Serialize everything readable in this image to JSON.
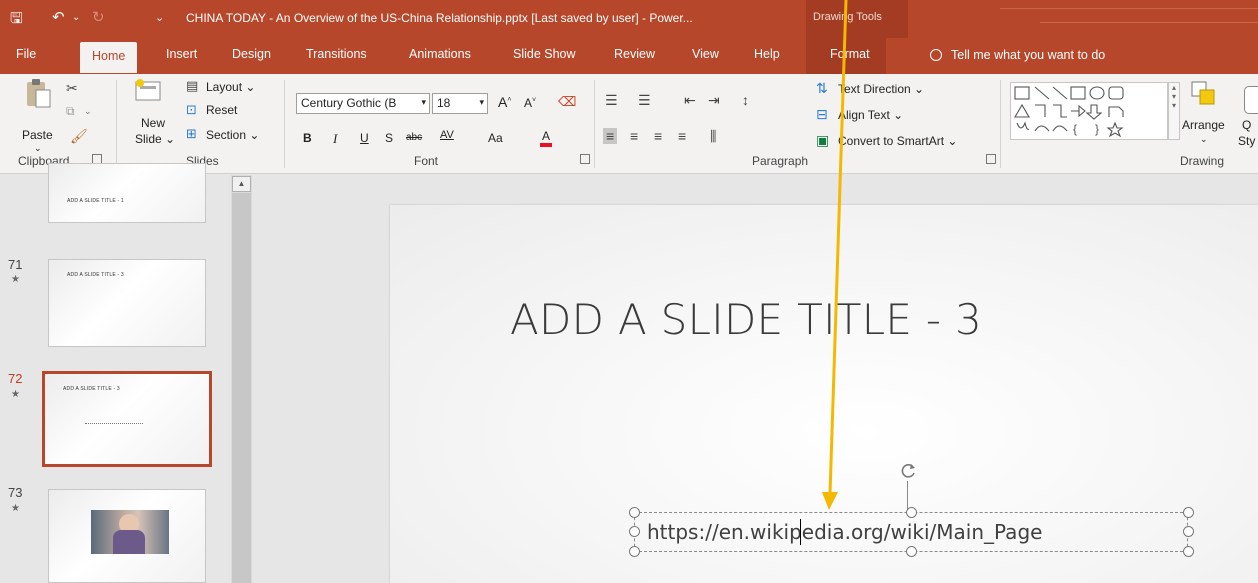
{
  "window": {
    "title": "CHINA TODAY - An Overview of the US-China Relationship.pptx [Last saved by user]  -  Power...",
    "context_title": "Drawing Tools"
  },
  "tabs": [
    {
      "label": "File"
    },
    {
      "label": "Home"
    },
    {
      "label": "Insert"
    },
    {
      "label": "Design"
    },
    {
      "label": "Transitions"
    },
    {
      "label": "Animations"
    },
    {
      "label": "Slide Show"
    },
    {
      "label": "Review"
    },
    {
      "label": "View"
    },
    {
      "label": "Help"
    },
    {
      "label": "Format"
    }
  ],
  "tell_me": "Tell me what you want to do",
  "ribbon": {
    "clipboard": {
      "label": "Clipboard",
      "paste": "Paste"
    },
    "slides": {
      "label": "Slides",
      "new_slide_1": "New",
      "new_slide_2": "Slide ⌄",
      "layout": "Layout ⌄",
      "reset": "Reset",
      "section": "Section ⌄"
    },
    "font": {
      "label": "Font",
      "font_name": "Century Gothic (B",
      "font_size": "18",
      "bold": "B",
      "italic": "I",
      "underline": "U",
      "shadow": "S",
      "strike": "abc",
      "spacing": "AV",
      "case": "Aa",
      "color": "A"
    },
    "paragraph": {
      "label": "Paragraph",
      "text_direction": "Text Direction ⌄",
      "align_text": "Align Text ⌄",
      "smartart": "Convert to SmartArt ⌄"
    },
    "drawing": {
      "label": "Drawing",
      "arrange": "Arrange",
      "quick_styles": "Q",
      "quick_styles_2": "Sty"
    }
  },
  "thumbnails": [
    {
      "number": "",
      "title": "ADD A SLIDE TITLE - 1"
    },
    {
      "number": "71",
      "title": "ADD A SLIDE TITLE - 3"
    },
    {
      "number": "72",
      "title": "ADD A SLIDE TITLE - 3"
    },
    {
      "number": "73",
      "title": ""
    }
  ],
  "slide": {
    "title": "ADD A SLIDE TITLE - 3",
    "textbox": "https://en.wikipedia.org/wiki/Main_Page"
  },
  "colors": {
    "accent": "#b7472a",
    "annotation": "#f5b800"
  }
}
